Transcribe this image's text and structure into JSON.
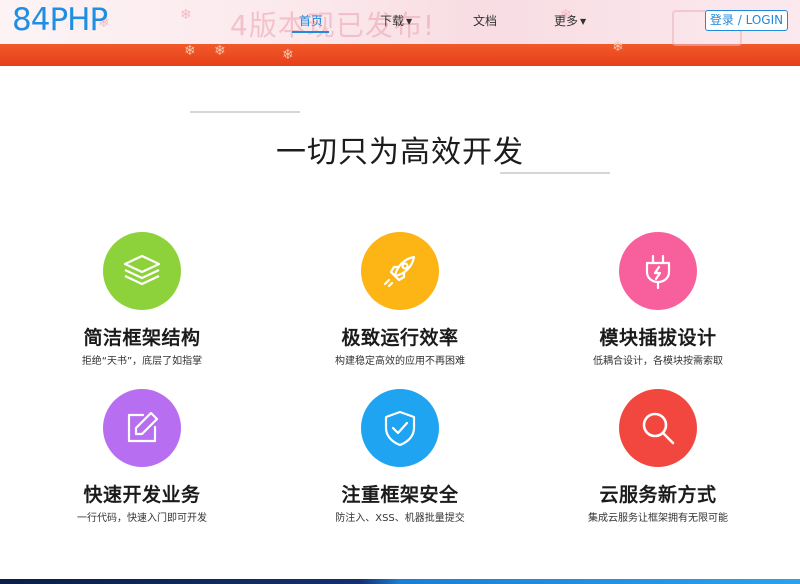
{
  "header": {
    "logo": "84PHP",
    "banner_text": "4版本现已发布!",
    "nav": {
      "home": "首页",
      "download": "下载",
      "docs": "文档",
      "more": "更多"
    },
    "login": "登录 / LOGIN"
  },
  "headline": "一切只为高效开发",
  "features": [
    {
      "title": "简洁框架结构",
      "desc": "拒绝“天书”，底层了如指掌",
      "icon": "layers-icon",
      "color": "#8ed23b"
    },
    {
      "title": "极致运行效率",
      "desc": "构建稳定高效的应用不再困难",
      "icon": "rocket-icon",
      "color": "#fcb515"
    },
    {
      "title": "模块插拔设计",
      "desc": "低耦合设计，各模块按需索取",
      "icon": "plug-icon",
      "color": "#f7609c"
    },
    {
      "title": "快速开发业务",
      "desc": "一行代码，快速入门即可开发",
      "icon": "edit-icon",
      "color": "#b86ef0"
    },
    {
      "title": "注重框架安全",
      "desc": "防注入、XSS、机器批量提交",
      "icon": "shield-check-icon",
      "color": "#1ea4f0"
    },
    {
      "title": "云服务新方式",
      "desc": "集成云服务让框架拥有无限可能",
      "icon": "search-icon",
      "color": "#f2473e"
    }
  ]
}
